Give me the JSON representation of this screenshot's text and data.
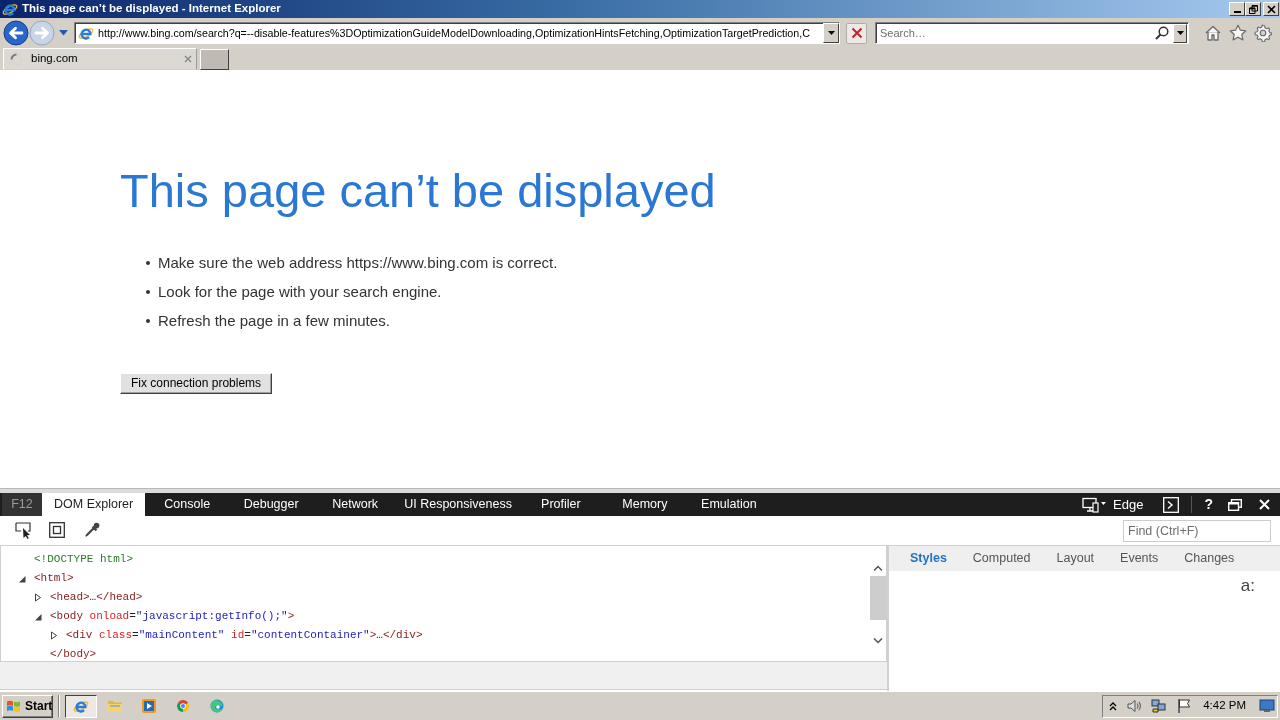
{
  "window": {
    "title": "This page can’t be displayed - Internet Explorer"
  },
  "navigation": {
    "back": {
      "disabled": false
    },
    "forward": {
      "disabled": true
    },
    "address": "http://www.bing.com/search?q=--disable-features%3DOptimizationGuideModelDownloading,OptimizationHintsFetching,OptimizationTargetPrediction,C",
    "search": {
      "placeholder": "Search…"
    }
  },
  "tabs": [
    {
      "label": "bing.com",
      "selected": true
    }
  ],
  "page": {
    "heading": "This page can’t be displayed",
    "suggestions": [
      "Make sure the web address https://www.bing.com is correct.",
      "Look for the page with your search engine.",
      "Refresh the page in a few minutes."
    ],
    "button": "Fix connection problems"
  },
  "devtools": {
    "f12_label": "F12",
    "tabs": [
      {
        "label": "DOM Explorer",
        "selected": true
      },
      {
        "label": "Console",
        "selected": false
      },
      {
        "label": "Debugger",
        "selected": false
      },
      {
        "label": "Network",
        "selected": false
      },
      {
        "label": "UI Responsiveness",
        "selected": false
      },
      {
        "label": "Profiler",
        "selected": false
      },
      {
        "label": "Memory",
        "selected": false
      },
      {
        "label": "Emulation",
        "selected": false
      }
    ],
    "document_mode": "Edge",
    "help": "?",
    "find": {
      "placeholder": "Find (Ctrl+F)"
    },
    "dom_tree": [
      {
        "tokens": [
          {
            "kind": "doctype",
            "text": "<!DOCTYPE html>"
          }
        ]
      },
      {
        "expanded": true,
        "tokens": [
          {
            "kind": "tag",
            "text": "<html>"
          }
        ],
        "children": [
          {
            "expanded": false,
            "tokens": [
              {
                "kind": "tag",
                "text": "<head>"
              },
              {
                "kind": "text",
                "text": "…"
              },
              {
                "kind": "tag",
                "text": "</head>"
              }
            ]
          },
          {
            "expanded": true,
            "tokens": [
              {
                "kind": "tag",
                "text": "<body"
              },
              {
                "kind": "attr-name",
                "text": " onload"
              },
              {
                "kind": "text",
                "text": "="
              },
              {
                "kind": "attr-value",
                "text": "\"javascript:getInfo();\""
              },
              {
                "kind": "tag",
                "text": ">"
              }
            ],
            "children": [
              {
                "expanded": false,
                "tokens": [
                  {
                    "kind": "tag",
                    "text": "<div"
                  },
                  {
                    "kind": "attr-name",
                    "text": " class"
                  },
                  {
                    "kind": "text",
                    "text": "="
                  },
                  {
                    "kind": "attr-value",
                    "text": "\"mainContent\""
                  },
                  {
                    "kind": "attr-name",
                    "text": " id"
                  },
                  {
                    "kind": "text",
                    "text": "="
                  },
                  {
                    "kind": "attr-value",
                    "text": "\"contentContainer\""
                  },
                  {
                    "kind": "tag",
                    "text": ">"
                  },
                  {
                    "kind": "text",
                    "text": "…"
                  },
                  {
                    "kind": "tag",
                    "text": "</div>"
                  }
                ]
              }
            ],
            "closing_tokens": [
              {
                "kind": "tag",
                "text": "</body>"
              }
            ]
          }
        ]
      }
    ],
    "side_tabs": [
      {
        "label": "Styles",
        "selected": true
      },
      {
        "label": "Computed",
        "selected": false
      },
      {
        "label": "Layout",
        "selected": false
      },
      {
        "label": "Events",
        "selected": false
      },
      {
        "label": "Changes",
        "selected": false
      }
    ],
    "pseudo_toggle": "a:"
  },
  "taskbar": {
    "start": "Start",
    "quick_launch": [
      {
        "selected": true
      },
      {
        "selected": false
      },
      {
        "selected": false
      },
      {
        "selected": false
      },
      {
        "selected": false
      }
    ],
    "clock": "4:42 PM"
  }
}
